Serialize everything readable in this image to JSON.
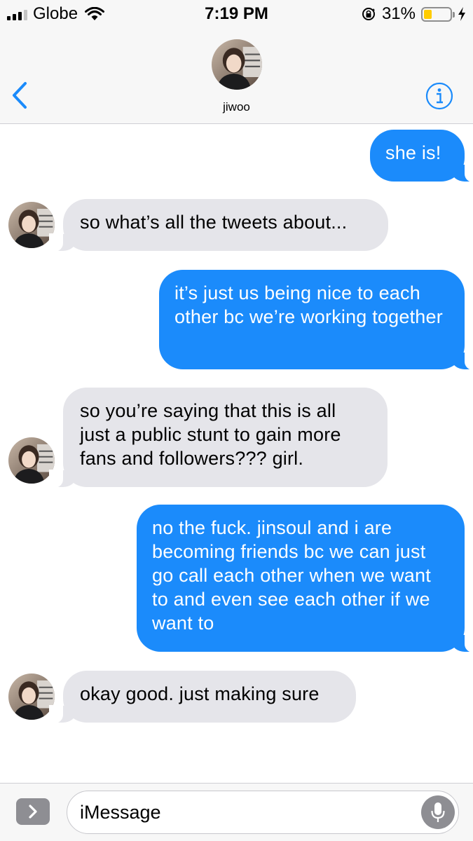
{
  "status_bar": {
    "carrier": "Globe",
    "time": "7:19 PM",
    "battery_percent": "31%",
    "battery_level": 0.31,
    "battery_color": "#ffcc00",
    "icons": [
      "signal-icon",
      "wifi-icon",
      "orientation-lock-icon",
      "battery-icon",
      "charging-bolt-icon"
    ]
  },
  "header": {
    "contact_name": "jiwoo",
    "back_icon": "chevron-left-icon",
    "info_icon": "info-icon",
    "accent_color": "#1b8bfb"
  },
  "messages": [
    {
      "direction": "outgoing",
      "text": "she is!"
    },
    {
      "direction": "incoming",
      "text": "so what’s all the tweets about..."
    },
    {
      "direction": "outgoing",
      "text": "it’s just us being nice to each other bc we’re working together"
    },
    {
      "direction": "incoming",
      "text": "so you’re saying that this is all just a public stunt to gain more fans and followers??? girl."
    },
    {
      "direction": "outgoing",
      "text": "no the fuck. jinsoul and i are becoming friends bc we can just go call each other when we want to and even see each other if we want to"
    },
    {
      "direction": "incoming",
      "text": "okay good. just making sure"
    }
  ],
  "input": {
    "placeholder": "iMessage",
    "apps_icon": "chevron-right-icon",
    "mic_icon": "microphone-icon"
  }
}
